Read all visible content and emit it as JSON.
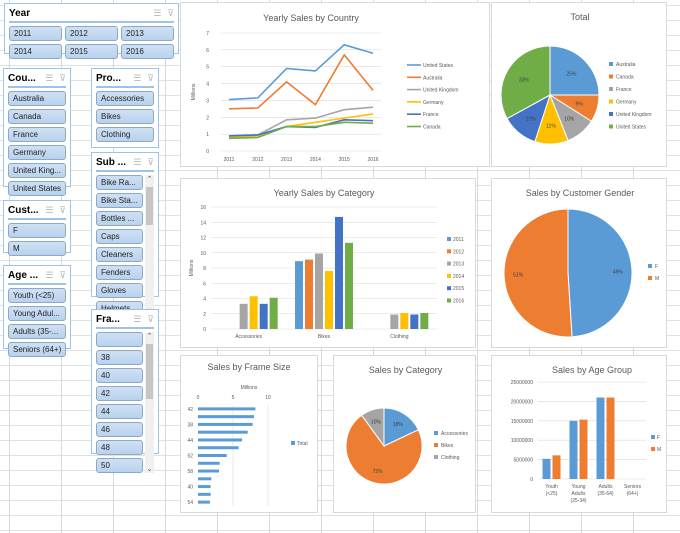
{
  "slicers": {
    "year": {
      "title": "Year",
      "items": [
        "2011",
        "2012",
        "2013",
        "2014",
        "2015",
        "2016"
      ]
    },
    "country": {
      "title": "Cou...",
      "items": [
        "Australia",
        "Canada",
        "France",
        "Germany",
        "United King...",
        "United States"
      ]
    },
    "product": {
      "title": "Pro...",
      "items": [
        "Accessories",
        "Bikes",
        "Clothing"
      ]
    },
    "subcategory": {
      "title": "Sub ...",
      "items": [
        "Bike Ra...",
        "Bike Sta...",
        "Bottles ...",
        "Caps",
        "Cleaners",
        "Fenders",
        "Gloves",
        "Helmets"
      ]
    },
    "customer": {
      "title": "Cust...",
      "items": [
        "F",
        "M"
      ]
    },
    "age": {
      "title": "Age ...",
      "items": [
        "Youth (<25)",
        "Young Adul...",
        "Adults (35-...",
        "Seniors (64+)"
      ]
    },
    "frame": {
      "title": "Fra...",
      "items": [
        "",
        "38",
        "40",
        "42",
        "44",
        "46",
        "48",
        "50"
      ]
    },
    "icons": {
      "multiselect": "multi-select-icon",
      "clear": "clear-filter-icon",
      "up": "▲",
      "down": "▼"
    }
  },
  "chart_data": [
    {
      "id": "yearly-sales-by-country",
      "type": "line",
      "title": "Yearly Sales by Country",
      "ylabel": "Millions",
      "x": [
        "2011",
        "2012",
        "2013",
        "2014",
        "2015",
        "2016"
      ],
      "ylim": [
        0,
        7
      ],
      "yticks": [
        "0",
        "1",
        "2",
        "3",
        "4",
        "5",
        "6",
        "7"
      ],
      "grid": true,
      "legend": "right",
      "series": [
        {
          "name": "United States",
          "color": "#5b9bd5",
          "values": [
            3.05,
            3.15,
            4.9,
            4.75,
            6.3,
            5.8
          ]
        },
        {
          "name": "Australia",
          "color": "#ed7d31",
          "values": [
            2.5,
            2.55,
            4.1,
            2.75,
            5.7,
            3.6
          ]
        },
        {
          "name": "United Kingdom",
          "color": "#a5a5a5",
          "values": [
            0.85,
            0.95,
            1.85,
            1.95,
            2.45,
            2.6
          ]
        },
        {
          "name": "Germany",
          "color": "#ffc000",
          "values": [
            0.8,
            0.9,
            1.45,
            1.7,
            1.95,
            2.2
          ]
        },
        {
          "name": "France",
          "color": "#4472c4",
          "values": [
            0.9,
            0.95,
            1.45,
            1.4,
            1.85,
            1.8
          ]
        },
        {
          "name": "Canada",
          "color": "#70ad47",
          "values": [
            0.75,
            0.8,
            1.45,
            1.45,
            1.7,
            1.65
          ]
        }
      ]
    },
    {
      "id": "total",
      "type": "pie",
      "title": "Total",
      "legend": "right",
      "categories": [
        "Australia",
        "Canada",
        "France",
        "Germany",
        "United Kingdom",
        "United States"
      ],
      "values": [
        25,
        9,
        10,
        11,
        12,
        33
      ],
      "labels": [
        "25%",
        "9%",
        "10%",
        "11%",
        "12%",
        "33%"
      ],
      "colors": [
        "#5b9bd5",
        "#ed7d31",
        "#a5a5a5",
        "#ffc000",
        "#4472c4",
        "#70ad47"
      ]
    },
    {
      "id": "yearly-sales-by-category",
      "type": "bar",
      "title": "Yearly Sales by Category",
      "ylabel": "Millions",
      "categories": [
        "Accessories",
        "Bikes",
        "Clothing"
      ],
      "ylim": [
        0,
        16
      ],
      "yticks": [
        "0",
        "2",
        "4",
        "6",
        "8",
        "10",
        "12",
        "14",
        "16"
      ],
      "grid": true,
      "legend": "right",
      "series": [
        {
          "name": "2011",
          "color": "#5b9bd5",
          "values": [
            0,
            8.9,
            0
          ]
        },
        {
          "name": "2012",
          "color": "#ed7d31",
          "values": [
            0,
            9.1,
            0
          ]
        },
        {
          "name": "2013",
          "color": "#a5a5a5",
          "values": [
            3.3,
            9.9,
            1.9
          ]
        },
        {
          "name": "2014",
          "color": "#ffc000",
          "values": [
            4.3,
            7.6,
            2.1
          ]
        },
        {
          "name": "2015",
          "color": "#4472c4",
          "values": [
            3.3,
            14.7,
            1.9
          ]
        },
        {
          "name": "2016",
          "color": "#70ad47",
          "values": [
            4.1,
            11.3,
            2.1
          ]
        }
      ]
    },
    {
      "id": "sales-by-customer-gender",
      "type": "pie",
      "title": "Sales by Customer Gender",
      "legend": "right",
      "categories": [
        "F",
        "M"
      ],
      "values": [
        49,
        51
      ],
      "labels": [
        "49%",
        "51%"
      ],
      "colors": [
        "#5b9bd5",
        "#ed7d31"
      ]
    },
    {
      "id": "sales-by-frame-size",
      "type": "bar",
      "orientation": "horizontal",
      "title": "Sales by Frame Size",
      "xlabel": "Millions",
      "xlim": [
        0,
        10
      ],
      "xticks": [
        "0",
        "5",
        "10"
      ],
      "categories": [
        "42",
        "",
        "38",
        "",
        "44",
        "",
        "62",
        "",
        "58",
        "",
        "40",
        "",
        "54"
      ],
      "values": [
        8.2,
        8.0,
        7.8,
        7.1,
        6.3,
        5.8,
        4.1,
        3.1,
        3.0,
        1.9,
        1.8,
        1.8,
        1.7
      ],
      "series_name": "Total",
      "color": "#5b9bd5",
      "legend": "right"
    },
    {
      "id": "sales-by-category",
      "type": "pie",
      "title": "Sales by Category",
      "legend": "right",
      "categories": [
        "Accessories",
        "Bikes",
        "Clothing"
      ],
      "values": [
        18,
        72,
        10
      ],
      "labels": [
        "18%",
        "72%",
        "10%"
      ],
      "colors": [
        "#5b9bd5",
        "#ed7d31",
        "#a5a5a5"
      ]
    },
    {
      "id": "sales-by-age-group",
      "type": "bar",
      "title": "Sales by Age Group",
      "categories": [
        "Youth (<25)",
        "Young Adults (25-34)",
        "Adults (35-64)",
        "Seniors (64+)"
      ],
      "category_lines": [
        [
          "Youth",
          "(<25)"
        ],
        [
          "Young",
          "Adults",
          "(25-34)"
        ],
        [
          "Adults",
          "(35-64)"
        ],
        [
          "Seniors",
          "(64+)"
        ]
      ],
      "ylim": [
        0,
        25000000
      ],
      "yticks": [
        "0",
        "5000000",
        "10000000",
        "15000000",
        "20000000",
        "25000000"
      ],
      "grid": true,
      "legend": "right",
      "series": [
        {
          "name": "F",
          "color": "#5b9bd5",
          "values": [
            5200000,
            15000000,
            21000000,
            0
          ]
        },
        {
          "name": "M",
          "color": "#ed7d31",
          "values": [
            6100000,
            15300000,
            21000000,
            0
          ]
        }
      ]
    }
  ]
}
